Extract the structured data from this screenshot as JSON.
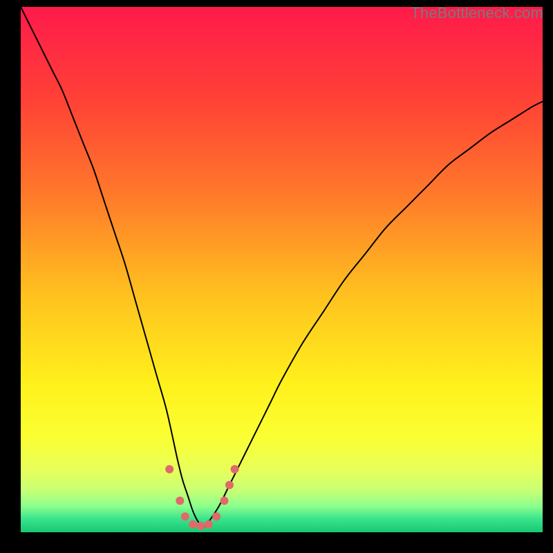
{
  "watermark": "TheBottleneck.com",
  "chart_data": {
    "type": "line",
    "title": "",
    "xlabel": "",
    "ylabel": "",
    "xlim": [
      0,
      100
    ],
    "ylim": [
      0,
      100
    ],
    "grid": false,
    "legend": false,
    "gradient_background": {
      "stops": [
        {
          "pos": 0.0,
          "color": "#ff1a4b"
        },
        {
          "pos": 0.18,
          "color": "#ff4236"
        },
        {
          "pos": 0.36,
          "color": "#ff7a2a"
        },
        {
          "pos": 0.55,
          "color": "#ffc21f"
        },
        {
          "pos": 0.72,
          "color": "#fff11c"
        },
        {
          "pos": 0.82,
          "color": "#fbff33"
        },
        {
          "pos": 0.88,
          "color": "#e8ff5a"
        },
        {
          "pos": 0.92,
          "color": "#c8ff74"
        },
        {
          "pos": 0.95,
          "color": "#8dff8d"
        },
        {
          "pos": 0.975,
          "color": "#38e38b"
        },
        {
          "pos": 1.0,
          "color": "#19c873"
        }
      ]
    },
    "series": [
      {
        "name": "bottleneck-curve",
        "stroke": "#000000",
        "stroke_width": 2,
        "x": [
          0,
          2,
          4,
          6,
          8,
          10,
          12,
          14,
          16,
          18,
          20,
          22,
          24,
          26,
          28,
          30,
          31,
          32,
          33,
          34,
          35,
          36,
          38,
          40,
          42,
          44,
          46,
          48,
          50,
          54,
          58,
          62,
          66,
          70,
          74,
          78,
          82,
          86,
          90,
          94,
          98,
          100
        ],
        "y": [
          100,
          96,
          92,
          88,
          84,
          79,
          74,
          69,
          63,
          57,
          51,
          44,
          37,
          30,
          23,
          14,
          10,
          7,
          4,
          2,
          1,
          2,
          5,
          9,
          13,
          17,
          21,
          25,
          29,
          36,
          42,
          48,
          53,
          58,
          62,
          66,
          70,
          73,
          76,
          78.5,
          81,
          82
        ]
      }
    ],
    "markers": {
      "name": "curve-dots",
      "color": "#e06a6a",
      "radius": 6,
      "points": [
        {
          "x": 28.5,
          "y": 12
        },
        {
          "x": 30.5,
          "y": 6
        },
        {
          "x": 31.5,
          "y": 3
        },
        {
          "x": 33.0,
          "y": 1.5
        },
        {
          "x": 34.5,
          "y": 1.2
        },
        {
          "x": 36.0,
          "y": 1.5
        },
        {
          "x": 37.5,
          "y": 3
        },
        {
          "x": 39.0,
          "y": 6
        },
        {
          "x": 40.0,
          "y": 9
        },
        {
          "x": 41.0,
          "y": 12
        }
      ]
    }
  }
}
